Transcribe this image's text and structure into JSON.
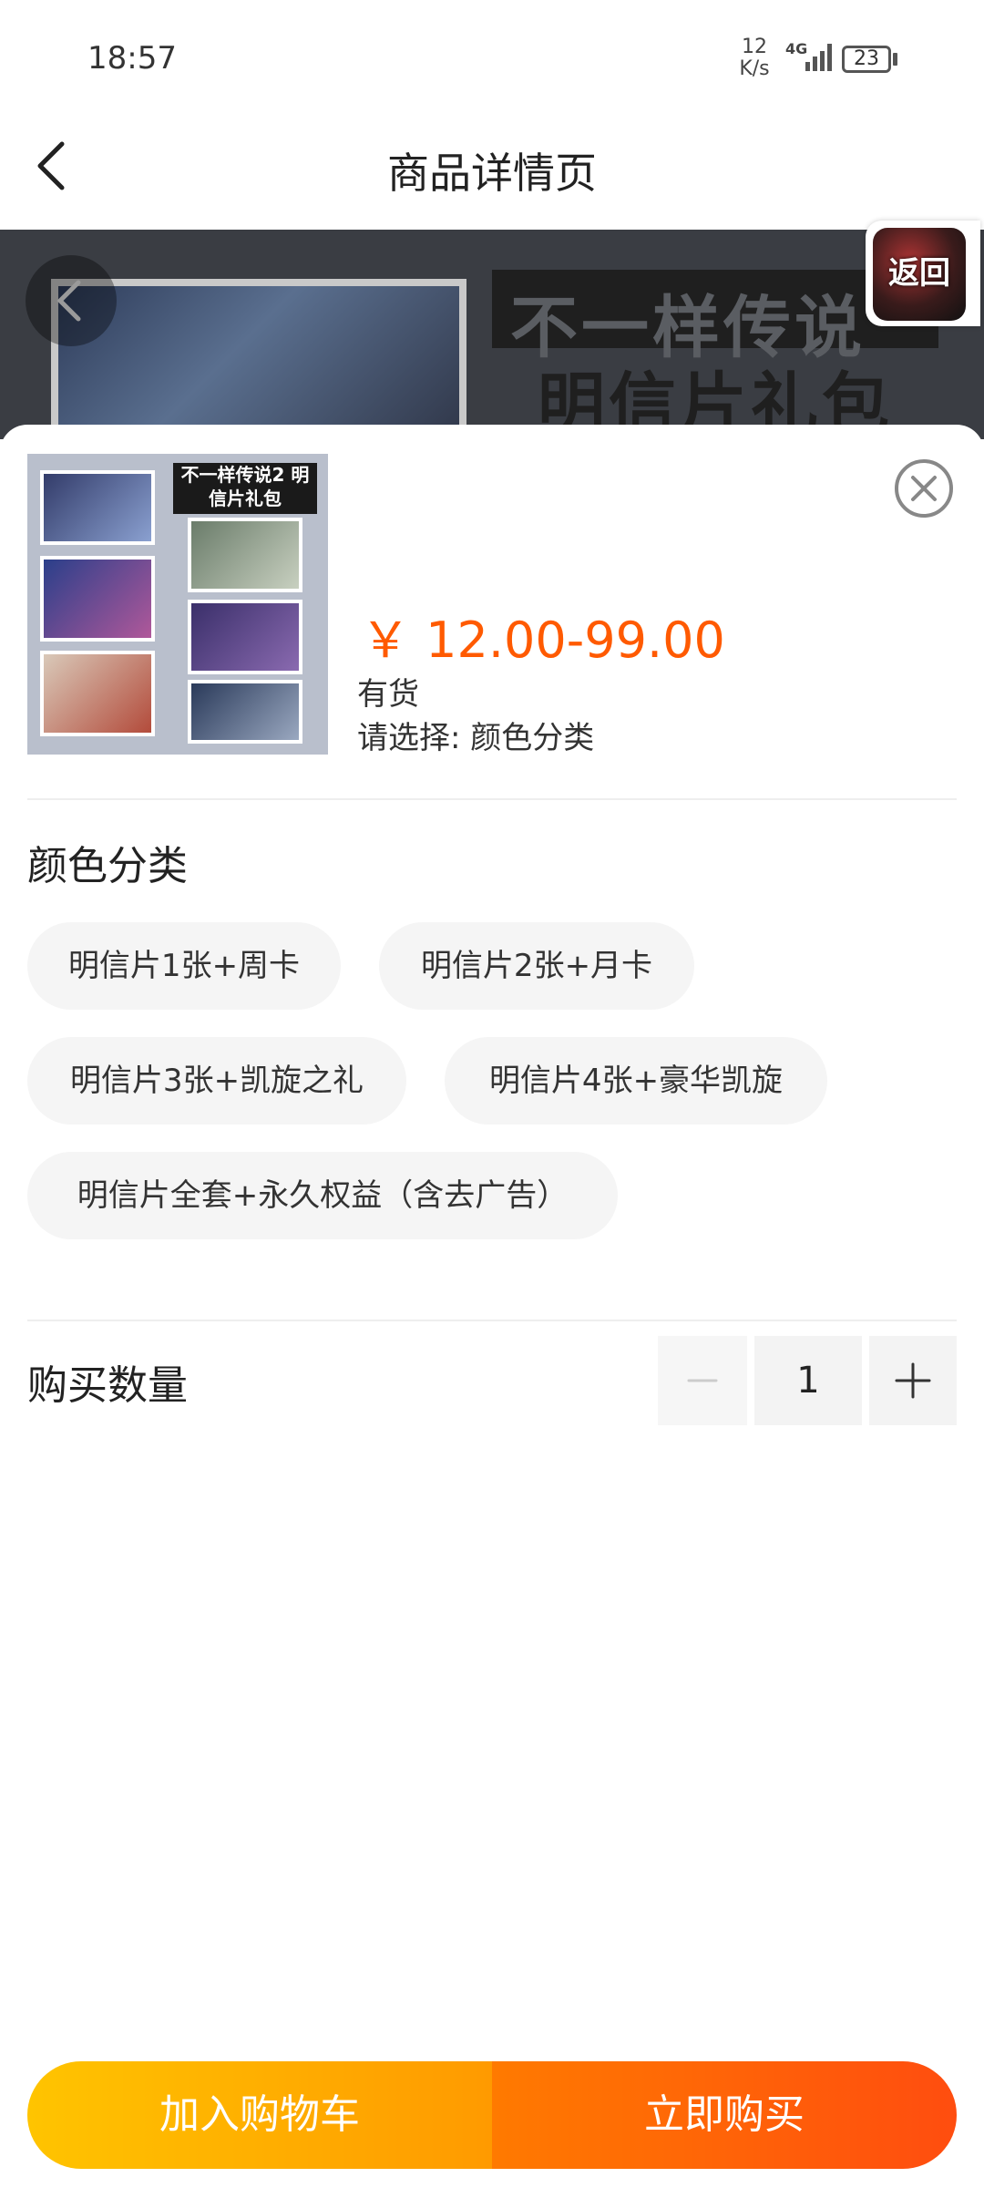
{
  "status_bar": {
    "time": "18:57",
    "net_speed_value": "12",
    "net_speed_unit": "K/s",
    "network_type": "4G",
    "battery": "23"
  },
  "nav": {
    "title": "商品详情页"
  },
  "banner": {
    "line1": "不一样传说",
    "line2": "明信片礼包",
    "float_back_label": "返回"
  },
  "product": {
    "thumb_title": "不一样传说2 明信片礼包",
    "price": "￥ 12.00-99.00",
    "stock": "有货",
    "choose_hint": "请选择: 颜色分类"
  },
  "options": {
    "title": "颜色分类",
    "items": [
      "明信片1张+周卡",
      "明信片2张+月卡",
      "明信片3张+凯旋之礼",
      "明信片4张+豪华凯旋",
      "明信片全套+永久权益（含去广告）"
    ]
  },
  "quantity": {
    "label": "购买数量",
    "value": "1"
  },
  "actions": {
    "add_to_cart": "加入购物车",
    "buy_now": "立即购买"
  },
  "colors": {
    "price": "#ff5a00",
    "cart_gradient_start": "#ffc400",
    "buy_gradient_end": "#ff4d0f"
  }
}
